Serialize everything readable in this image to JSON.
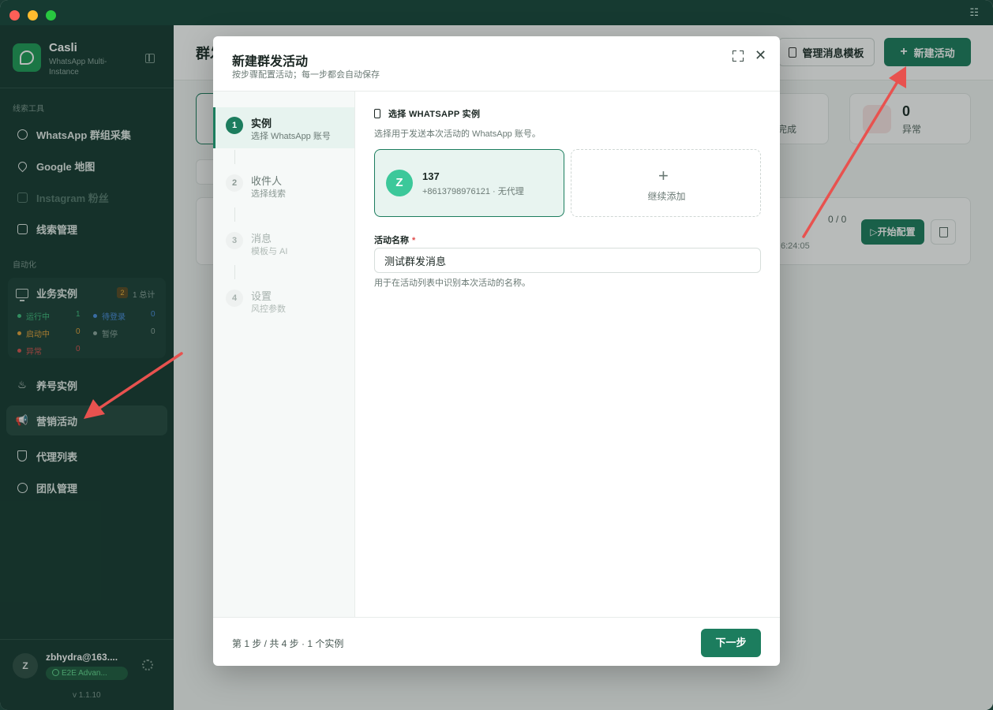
{
  "sidebar": {
    "brand_name": "Casli",
    "brand_sub": "WhatsApp Multi-Instance",
    "section_leads": "线索工具",
    "nav_groups": "WhatsApp 群组采集",
    "nav_maps": "Google 地图",
    "nav_instagram": "Instagram 粉丝",
    "nav_leads": "线索管理",
    "section_auto": "自动化",
    "biz": {
      "title": "业务实例",
      "badge": "2",
      "total": "1 总计",
      "running_label": "运行中",
      "running": "1",
      "pending_label": "待登录",
      "pending": "0",
      "starting_label": "启动中",
      "starting": "0",
      "paused_label": "暂停",
      "paused": "0",
      "error_label": "异常",
      "error": "0"
    },
    "nav_warmup": "养号实例",
    "nav_marketing": "营销活动",
    "nav_proxy": "代理列表",
    "nav_team": "团队管理",
    "user_initial": "Z",
    "user_email": "zbhydra@163....",
    "user_plan": "E2E Advan...",
    "version": "v 1.1.10"
  },
  "main": {
    "title": "群发活动",
    "btn_templates": "管理消息模板",
    "btn_new": "新建活动",
    "stat_done_label": "完成",
    "stat_error_num": "0",
    "stat_error_label": "异常",
    "row_progress": "0 / 0",
    "row_time": "6:24:05",
    "btn_start": "▷开始配置"
  },
  "modal": {
    "title": "新建群发活动",
    "subtitle": "按步骤配置活动；每一步都会自动保存",
    "steps": [
      {
        "num": "1",
        "title": "实例",
        "desc": "选择 WhatsApp 账号"
      },
      {
        "num": "2",
        "title": "收件人",
        "desc": "选择线索"
      },
      {
        "num": "3",
        "title": "消息",
        "desc": "模板与 AI"
      },
      {
        "num": "4",
        "title": "设置",
        "desc": "风控参数"
      }
    ],
    "section_title": "选择 WHATSAPP 实例",
    "section_desc": "选择用于发送本次活动的 WhatsApp 账号。",
    "instance": {
      "initial": "Z",
      "name": "137",
      "meta": "+8613798976121 · 无代理"
    },
    "add_label": "继续添加",
    "field_label": "活动名称",
    "field_required": "*",
    "field_value": "测试群发消息",
    "field_help": "用于在活动列表中识别本次活动的名称。",
    "footer_info": "第 1 步 / 共 4 步 · 1 个实例",
    "btn_next": "下一步"
  },
  "colors": {
    "accent": "#1c7d5e",
    "sidebar": "#163a31",
    "arrow": "#e8524f"
  }
}
